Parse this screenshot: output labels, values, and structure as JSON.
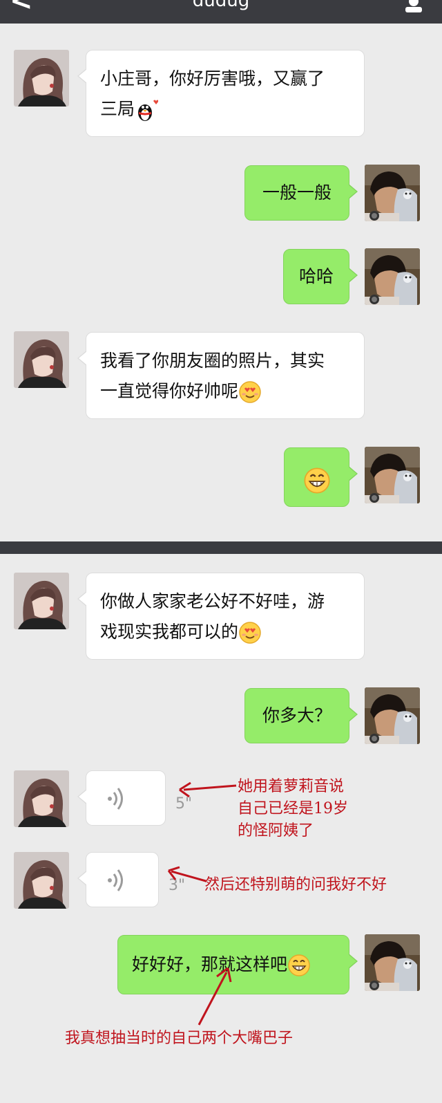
{
  "header": {
    "back_label": "<",
    "title": "dudug"
  },
  "messages": [
    {
      "side": "left",
      "text": "小庄哥，你好厉害哦，又赢了三局",
      "emoji": "qq-penguin-love-icon"
    },
    {
      "side": "right",
      "text": "一般一般"
    },
    {
      "side": "right",
      "text": "哈哈"
    },
    {
      "side": "left",
      "text": "我看了你朋友圈的照片，其实一直觉得你好帅呢",
      "emoji": "heart-eyes-emoji"
    },
    {
      "side": "right",
      "text": "",
      "emoji": "grin-emoji"
    },
    {
      "side": "left",
      "text": "你做人家家老公好不好哇，游戏现实我都可以的",
      "emoji": "heart-eyes-emoji"
    },
    {
      "side": "right",
      "text": "你多大？"
    },
    {
      "side": "left",
      "type": "voice",
      "duration": "5\""
    },
    {
      "side": "left",
      "type": "voice",
      "duration": "3\""
    },
    {
      "side": "right",
      "text": "好好好，那就这样吧",
      "emoji": "grin-emoji"
    }
  ],
  "bubble_lines": {
    "m1_line1": "小庄哥，你好厉害哦，又赢了",
    "m1_line2": "三局",
    "m4_line1": "我看了你朋友圈的照片，其实",
    "m4_line2": "一直觉得你好帅呢",
    "m6_line1": "你做人家家老公好不好哇，游",
    "m6_line2": "戏现实我都可以的"
  },
  "annotations": {
    "note1_line1": "她用着萝莉音说",
    "note1_line2": "自己已经是19岁",
    "note1_line3": "的怪阿姨了",
    "note2": "然后还特别萌的问我好不好",
    "note3": "我真想抽当时的自己两个大嘴巴子"
  },
  "colors": {
    "header_bg": "#3a3b40",
    "chat_bg": "#ebebeb",
    "bubble_right": "#95ec69",
    "bubble_left": "#ffffff",
    "annotation": "#c0141d"
  }
}
